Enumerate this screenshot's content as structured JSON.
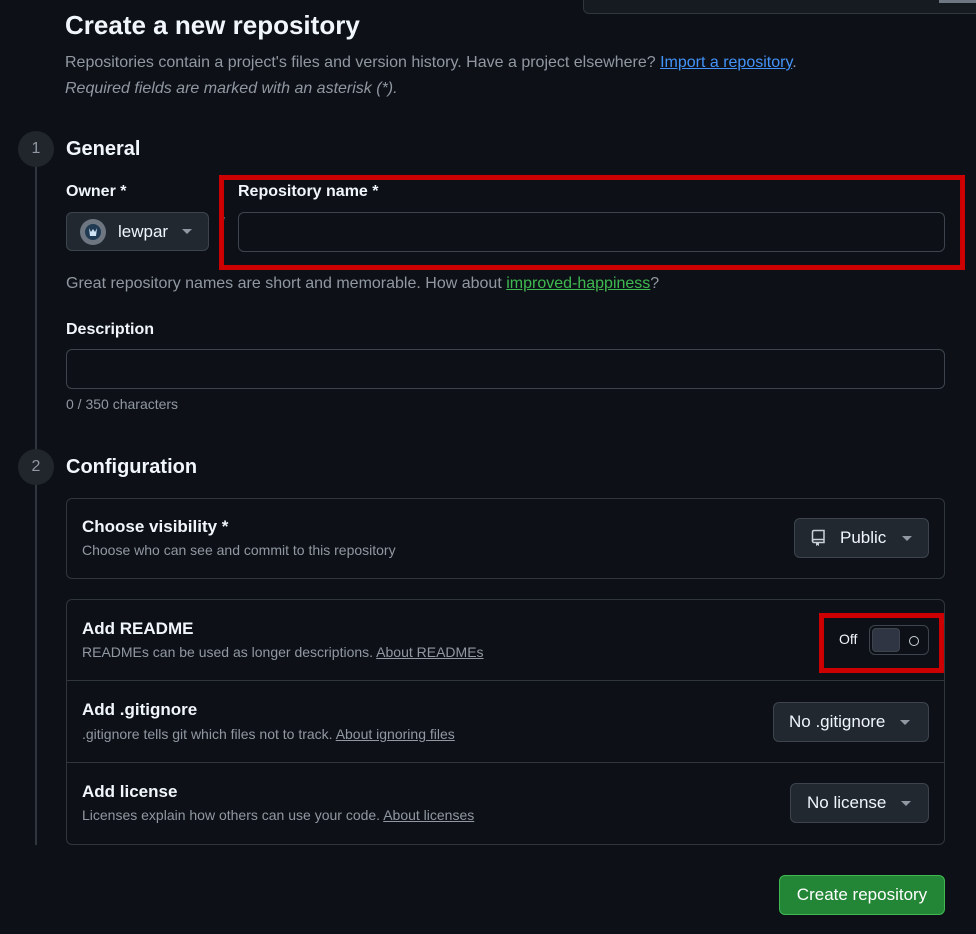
{
  "page": {
    "title": "Create a new repository",
    "intro_text": "Repositories contain a project's files and version history. Have a project elsewhere?",
    "import_link": "Import a repository",
    "intro_period": ".",
    "required_note": "Required fields are marked with an asterisk (*)."
  },
  "general": {
    "step": "1",
    "title": "General",
    "owner_label": "Owner *",
    "owner_value": "lewpar",
    "slash": "/",
    "repo_name_label": "Repository name *",
    "repo_name_value": "",
    "suggestion_prefix": "Great repository names are short and memorable. How about",
    "suggestion_name": "improved-happiness",
    "suggestion_suffix": "?",
    "description_label": "Description",
    "description_value": "",
    "char_count": "0 / 350 characters"
  },
  "configuration": {
    "step": "2",
    "title": "Configuration",
    "visibility": {
      "title": "Choose visibility *",
      "desc": "Choose who can see and commit to this repository",
      "value": "Public",
      "icon": "repo-icon"
    },
    "readme": {
      "title": "Add README",
      "desc": "READMEs can be used as longer descriptions.",
      "link": "About READMEs",
      "state_label": "Off",
      "enabled": false
    },
    "gitignore": {
      "title": "Add .gitignore",
      "desc": ".gitignore tells git which files not to track.",
      "link": "About ignoring files",
      "value": "No .gitignore"
    },
    "license": {
      "title": "Add license",
      "desc": "Licenses explain how others can use your code.",
      "link": "About licenses",
      "value": "No license"
    }
  },
  "actions": {
    "create_label": "Create repository"
  },
  "colors": {
    "background": "#0d1117",
    "primary_button": "#238636",
    "link": "#4493f8",
    "highlight": "#cc0000"
  }
}
